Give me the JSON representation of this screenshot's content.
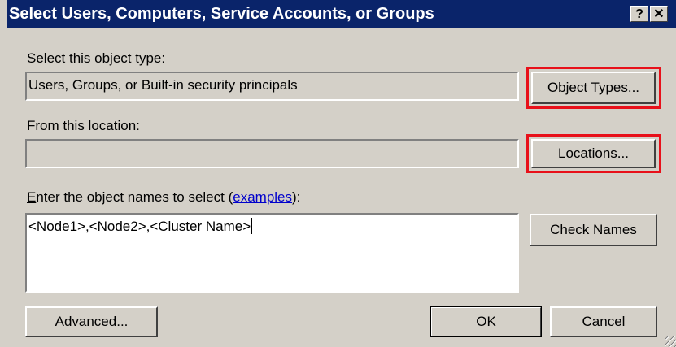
{
  "window": {
    "title": "Select Users, Computers, Service Accounts, or Groups",
    "help_glyph": "?",
    "close_glyph": "✕"
  },
  "object_type": {
    "label": "Select this object type:",
    "value": "Users, Groups, or Built-in security principals",
    "button_label": "Object Types..."
  },
  "location": {
    "label": "From this location:",
    "value": "",
    "button_label": "Locations..."
  },
  "names": {
    "label_prefix": "Enter the object names to select (",
    "label_link": "examples",
    "label_suffix": "):",
    "value": "<Node1>,<Node2>,<Cluster Name>",
    "check_button_label": "Check Names"
  },
  "footer": {
    "advanced_label": "Advanced...",
    "ok_label": "OK",
    "cancel_label": "Cancel"
  },
  "colors": {
    "titlebar": "#0a246a",
    "dialog_bg": "#d4d0c8",
    "highlight": "#e8101a",
    "link": "#0000cc"
  }
}
